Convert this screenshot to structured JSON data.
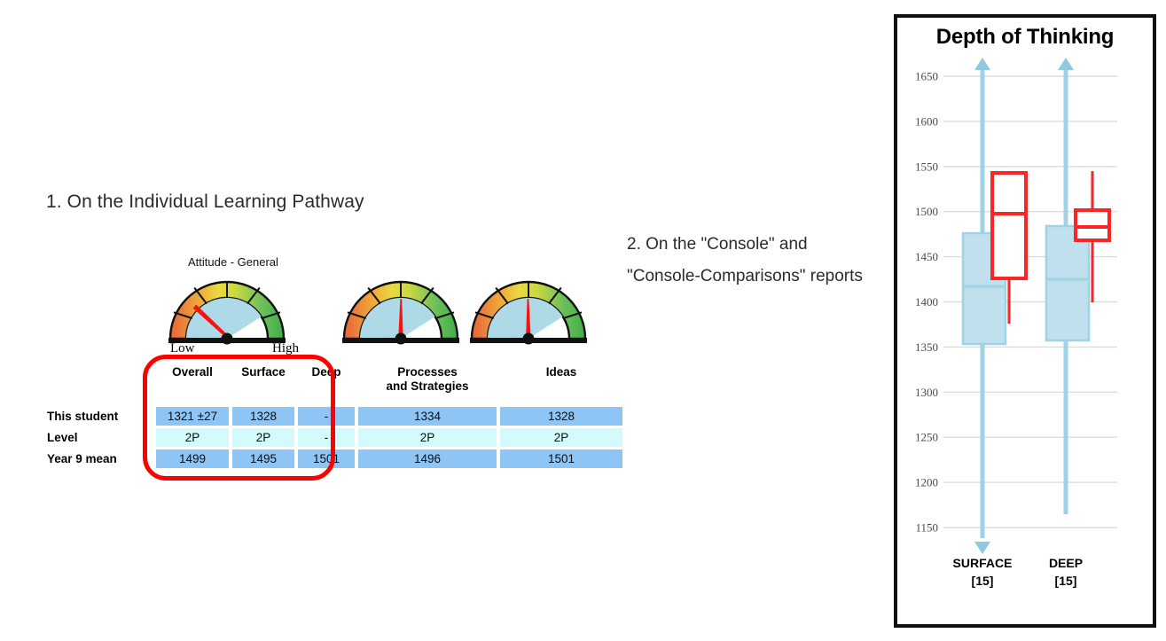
{
  "slide": {
    "point_1": "1. On the Individual Learning Pathway",
    "point_2": "2. On the \"Console\" and \"Console-Comparisons\" reports"
  },
  "gauges": {
    "title": "Attitude - General",
    "low_label": "Low",
    "high_label": "High",
    "items": [
      {
        "name": "gauge-attitude-general",
        "needle_angle_deg": 126,
        "wedge_end_deg": 33
      },
      {
        "name": "gauge-second",
        "needle_angle_deg": 91,
        "wedge_end_deg": 33
      },
      {
        "name": "gauge-third",
        "needle_angle_deg": 92,
        "wedge_end_deg": 33
      }
    ]
  },
  "table": {
    "columns": [
      "",
      "Overall",
      "Surface",
      "Deep",
      "Processes and Strategies",
      "Ideas"
    ],
    "column_labels": {
      "overall": "Overall",
      "surface": "Surface",
      "deep": "Deep",
      "processes": "Processes and Strategies",
      "processes_line1": "Processes",
      "processes_line2": "and Strategies",
      "ideas": "Ideas"
    },
    "rows": [
      {
        "label": "This student",
        "style": "blue",
        "cells": [
          "1321 ±27",
          "1328",
          "-",
          "1334",
          "1328"
        ]
      },
      {
        "label": "Level",
        "style": "cyan",
        "cells": [
          "2P",
          "2P",
          "-",
          "2P",
          "2P"
        ]
      },
      {
        "label": "Year 9 mean",
        "style": "blue",
        "cells": [
          "1499",
          "1495",
          "1501",
          "1496",
          "1501"
        ]
      }
    ],
    "highlight_color": "#ff0000",
    "cell_blue": "#8ec5f4",
    "cell_cyan": "#d4fbfb"
  },
  "chart_data": {
    "type": "box",
    "title": "Depth of Thinking",
    "xlabel": "",
    "ylabel": "",
    "ylim": [
      1120,
      1672
    ],
    "yticks": [
      1650,
      1600,
      1550,
      1500,
      1450,
      1400,
      1350,
      1300,
      1250,
      1200,
      1150
    ],
    "ytick_labels": [
      "1650",
      "1600",
      "1550",
      "1500",
      "1450",
      "1400",
      "1350",
      "1300",
      "1250",
      "1200",
      "1150"
    ],
    "grid": true,
    "legend": "none",
    "categories": [
      "SURFACE",
      "DEEP"
    ],
    "category_labels": [
      {
        "name": "SURFACE",
        "count": "[15]"
      },
      {
        "name": "DEEP",
        "count": "[15]"
      }
    ],
    "series": [
      {
        "name": "group-range",
        "color": "#a8d5e5",
        "boxes": [
          {
            "category": "SURFACE",
            "whisker_low": 1140,
            "q1": 1353,
            "median": 1417,
            "q3": 1476,
            "whisker_high": 1662,
            "cap_low": "triangle-down",
            "cap_high": "triangle-up"
          },
          {
            "category": "DEEP",
            "whisker_low": 1167,
            "q1": 1357,
            "median": 1425,
            "q3": 1484,
            "whisker_high": 1662,
            "cap_low": "none",
            "cap_high": "triangle-up"
          }
        ]
      },
      {
        "name": "student-range",
        "color": "#fa2525",
        "boxes": [
          {
            "category": "SURFACE",
            "whisker_low": 1372,
            "q1": 1423,
            "median": 1495,
            "q3": 1540,
            "whisker_high": 1541,
            "cap_low": "none",
            "cap_high": "none"
          },
          {
            "category": "DEEP",
            "whisker_low": 1399,
            "q1": 1469,
            "median": 1483,
            "q3": 1502,
            "whisker_high": 1544,
            "cap_low": "none",
            "cap_high": "none"
          }
        ]
      }
    ]
  }
}
